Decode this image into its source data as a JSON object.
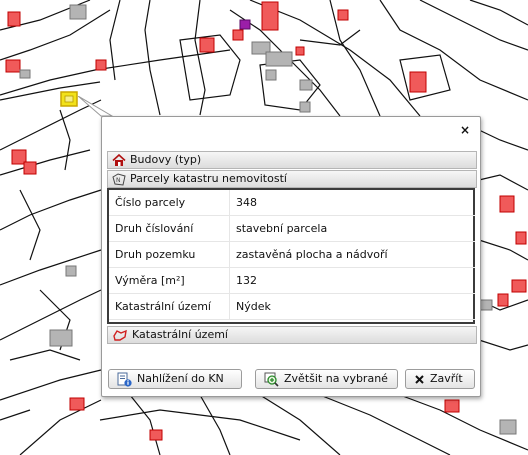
{
  "popup": {
    "close_label": "×",
    "sections": {
      "buildings": "Budovy (typ)",
      "parcels": "Parcely katastru nemovitostí",
      "cadastral": "Katastrální území"
    },
    "attributes": [
      {
        "key": "Číslo parcely",
        "value": "348"
      },
      {
        "key": "Druh číslování",
        "value": "stavební parcela"
      },
      {
        "key": "Druh pozemku",
        "value": "zastavěná plocha a nádvoří"
      },
      {
        "key": "Výměra [m²]",
        "value": "132"
      },
      {
        "key": "Katastrální území",
        "value": "Nýdek"
      }
    ],
    "buttons": {
      "view_kn": "Nahlížení do KN",
      "zoom_selected": "Zvětšit na vybrané",
      "close": "Zavřít"
    }
  },
  "colors": {
    "building": "#f05a5a",
    "building_outline": "#c00000",
    "highlight": "#f2e21a",
    "special_building": "#9b1ea8",
    "grey_building": "#b4b4b4"
  }
}
